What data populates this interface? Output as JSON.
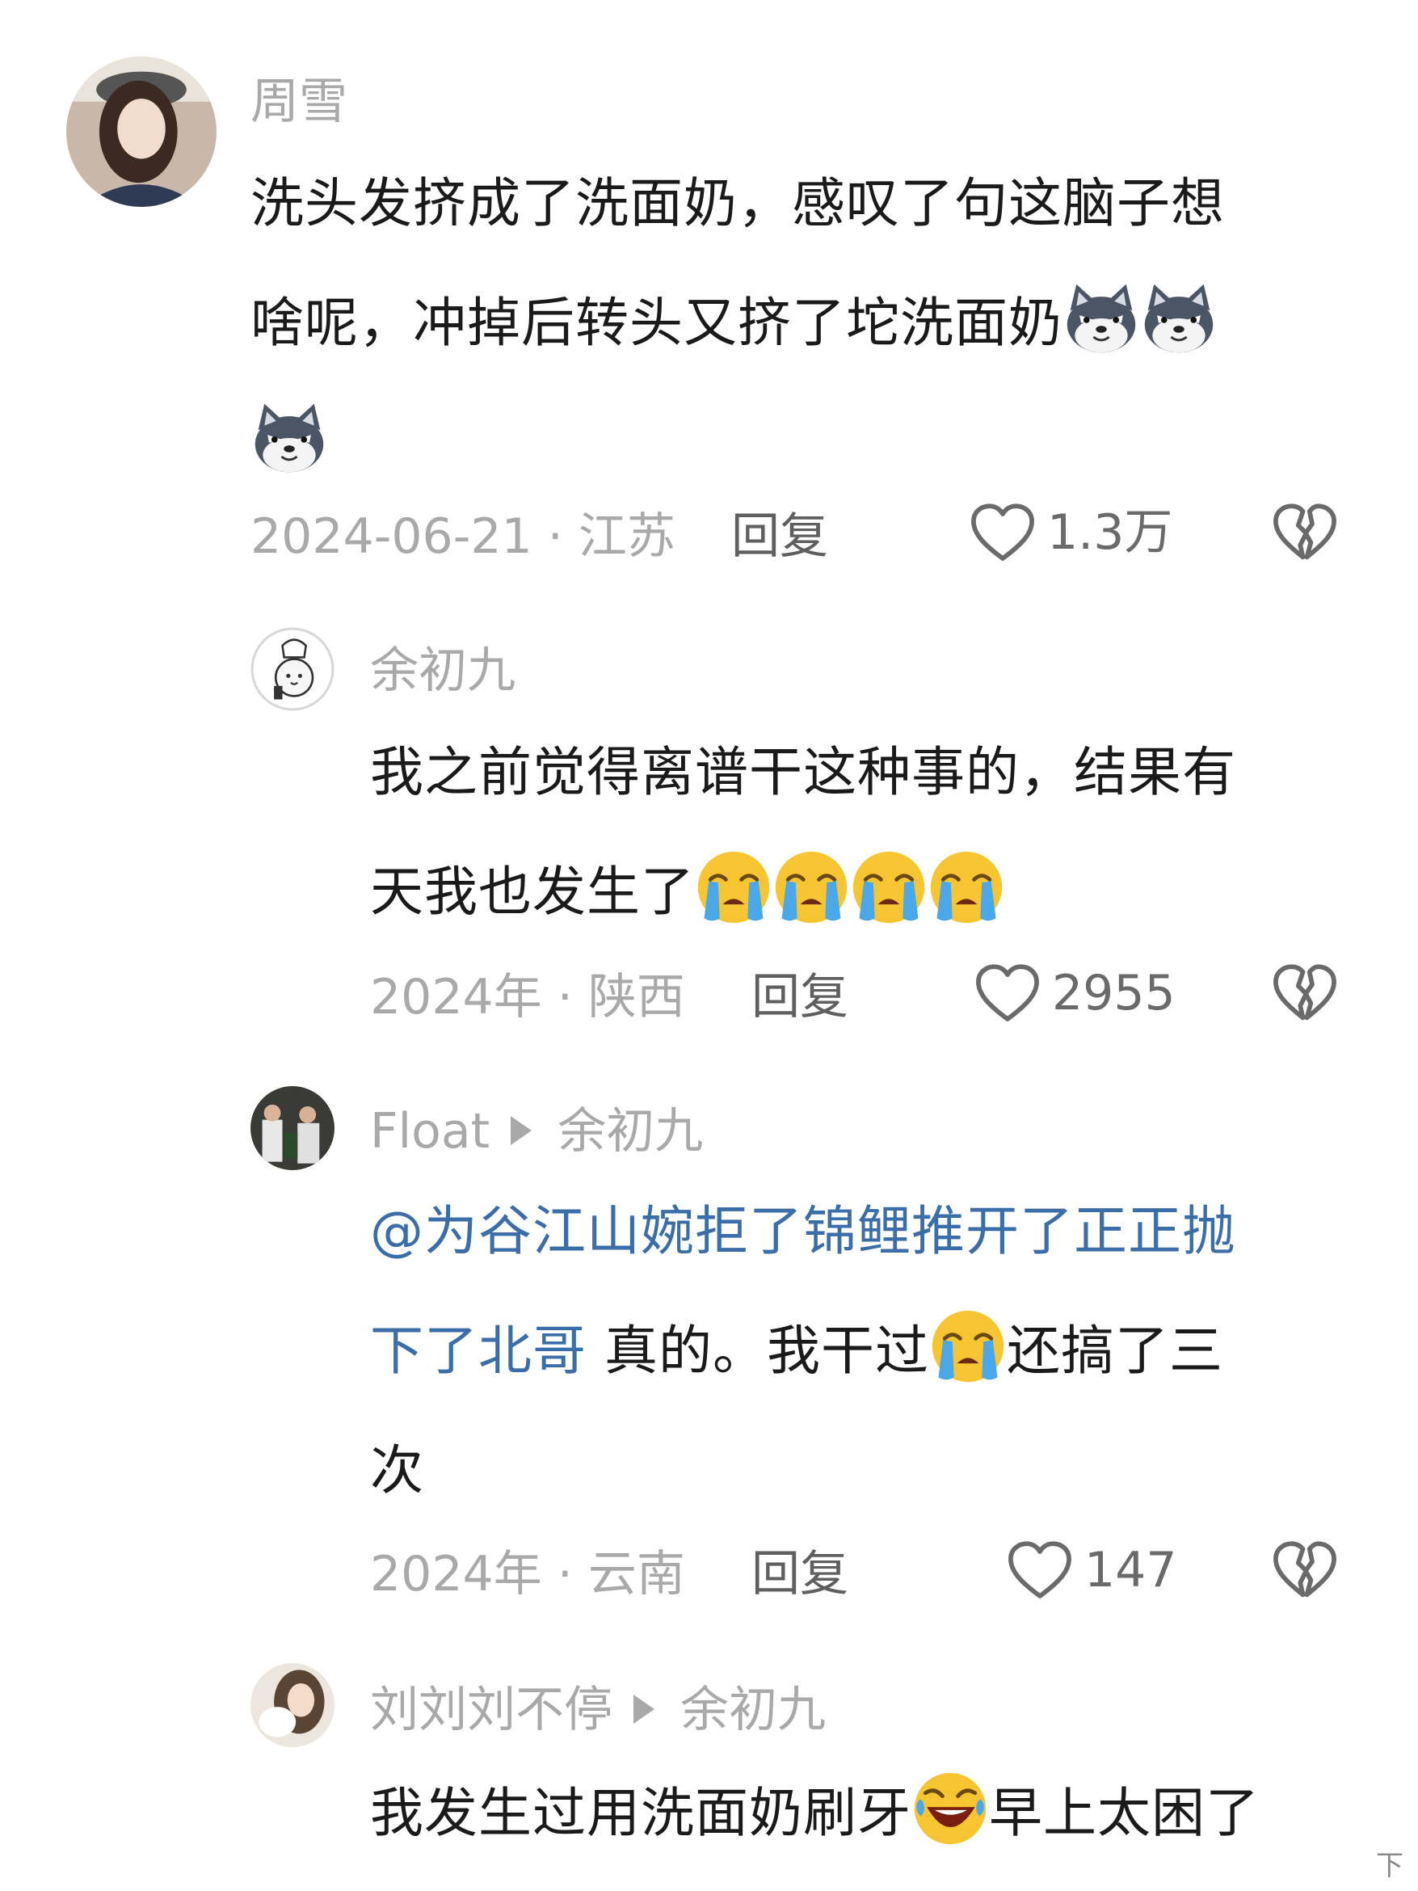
{
  "comments": [
    {
      "username": "周雪",
      "text_segments": [
        "洗头发挤成了洗面奶，感叹了句这脑子想",
        "啥呢，冲掉后转头又挤了坨洗面奶"
      ],
      "emoji": [
        "wolf-emoji",
        "wolf-emoji",
        "wolf-emoji"
      ],
      "date_location": "2024-06-21 · 江苏",
      "reply_label": "回复",
      "likes": "1.3万"
    },
    {
      "username": "余初九",
      "text_segments": [
        "我之前觉得离谱干这种事的，结果有",
        "天我也发生了"
      ],
      "emoji": [
        "crying-face-emoji",
        "crying-face-emoji",
        "crying-face-emoji",
        "crying-face-emoji"
      ],
      "date_location": "2024年 · 陕西",
      "reply_label": "回复",
      "likes": "2955"
    },
    {
      "username": "Float",
      "reply_to": "余初九",
      "mention": [
        "@为谷江山婉拒了锦鲤推开了正正抛",
        "下了北哥"
      ],
      "text_segments": [
        " 真的。我干过",
        "还搞了三",
        "次"
      ],
      "emoji": [
        "crying-face-emoji"
      ],
      "date_location": "2024年 · 云南",
      "reply_label": "回复",
      "likes": "147"
    },
    {
      "username": "刘刘刘不停",
      "reply_to": "余初九",
      "text_segments": [
        "我发生过用洗面奶刷牙",
        "早上太困了"
      ],
      "emoji": [
        "laughing-crying-emoji"
      ]
    }
  ],
  "corner_mark": "下",
  "colors": {
    "text": "#1a1a1a",
    "muted": "#a9a9a9",
    "mention": "#3b6ea8",
    "emoji_yellow": "#f7c531",
    "tear_blue": "#4aa8e8"
  }
}
